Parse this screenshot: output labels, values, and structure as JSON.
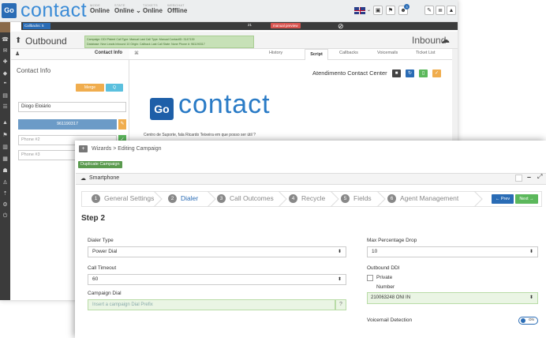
{
  "top": {
    "logo": "Go",
    "brand": "contact",
    "status_groups": [
      {
        "label": "MODE",
        "value": "Online"
      },
      {
        "label": "STATE",
        "value": "Online ⌄"
      },
      {
        "label": "TICKETS",
        "value": "Online"
      },
      {
        "label": "WEBCHAT",
        "value": "Offline"
      }
    ]
  },
  "callbar": {
    "label": "Callbacks: 5",
    "number": "21",
    "preview": "manual preview",
    "status_icon": "⊘"
  },
  "infobar": {
    "outbound": "Outbound",
    "inbound": "Inbound",
    "campaign_lines": [
      "Campaign: DDI Pisteel   Call Type: Manual  Last Call Type: Manual  ContactID: 3147139",
      "Database: New Leads Inbound 10  Origin: Callback  Last Call State: None  Phone #: 961190317"
    ]
  },
  "left": {
    "tab": "Contact Info",
    "title": "Contact Info",
    "merge": "Merge",
    "search": "Q",
    "name": "Diogo Eloiário",
    "phone1": "961190317",
    "phone2": "Phone #2",
    "phone3": "Phone #3"
  },
  "tabs": [
    "History",
    "Script",
    "Callbacks",
    "Voicemails",
    "Ticket List"
  ],
  "script": {
    "center_title": "Atendimento Contact Center",
    "logo_box": "Go",
    "logo_text": "contact",
    "text": "Centro de Suporte, fala Ricardo Teixeira em que posso ser útil ?"
  },
  "front": {
    "breadcrumb": "Wizards > Editing Campaign",
    "duplicate": "Duplicate Campaign",
    "panel_title": "Smartphone",
    "steps": [
      {
        "num": "1",
        "label": "General Settings"
      },
      {
        "num": "2",
        "label": "Dialer"
      },
      {
        "num": "3",
        "label": "Call Outcomes"
      },
      {
        "num": "4",
        "label": "Recycle"
      },
      {
        "num": "5",
        "label": "Fields"
      },
      {
        "num": "6",
        "label": "Agent Management"
      }
    ],
    "prev": "← Prev",
    "next": "Next →",
    "step_title": "Step 2",
    "fields": {
      "dialer_type_label": "Dialer Type",
      "dialer_type": "Power Dial",
      "call_timeout_label": "Call Timeout",
      "call_timeout": "60",
      "campaign_dial_label": "Campaign Dial",
      "campaign_dial_placeholder": "Insert a campaign Dial Prefix",
      "max_drop_label": "Max Percentage Drop",
      "max_drop": "10",
      "outbound_ddi_label": "Outbound DDI",
      "private_label": "Private",
      "number_label": "Number",
      "number_value": "210063248 ONI IN",
      "voicemail_label": "Voicemail Detection",
      "toggle": "ON"
    }
  },
  "colors": {
    "brand": "#2a6cb5",
    "active_step": "#2a6cb5",
    "merge": "#f0ad4e",
    "success": "#5cb85c"
  }
}
